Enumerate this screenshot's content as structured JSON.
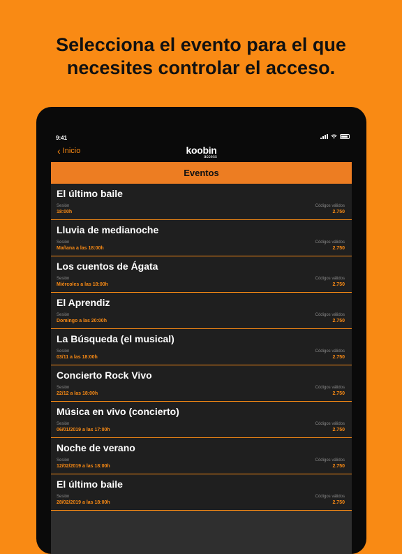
{
  "headline": {
    "line1": "Selecciona el evento para el que",
    "line2": "necesites controlar el acceso."
  },
  "status_bar": {
    "time": "9:41"
  },
  "nav": {
    "back_label": "Inicio",
    "logo_main": "koobin",
    "logo_sub": "access"
  },
  "screen_title": "Eventos",
  "labels": {
    "session": "Sesión",
    "codes": "Códigos válidos"
  },
  "events": [
    {
      "title": "El último baile",
      "session": "18:00h",
      "codes": "2.750"
    },
    {
      "title": "Lluvia de medianoche",
      "session": "Mañana a las 18:00h",
      "codes": "2.750"
    },
    {
      "title": "Los cuentos de Ágata",
      "session": "Miércoles a las 18:00h",
      "codes": "2.750"
    },
    {
      "title": "El Aprendiz",
      "session": "Domingo a las 20:00h",
      "codes": "2.750"
    },
    {
      "title": "La Búsqueda (el musical)",
      "session": "03/11 a las 18:00h",
      "codes": "2.750"
    },
    {
      "title": "Concierto Rock Vivo",
      "session": "22/12 a las 18:00h",
      "codes": "2.750"
    },
    {
      "title": "Música en vivo (concierto)",
      "session": "06/01/2019 a las 17:00h",
      "codes": "2.750"
    },
    {
      "title": "Noche de verano",
      "session": "12/02/2019 a las 18:00h",
      "codes": "2.750"
    },
    {
      "title": "El último baile",
      "session": "28/02/2019 a las 18:00h",
      "codes": "2.750"
    }
  ],
  "colors": {
    "accent": "#F98A14",
    "header": "#ED7D22",
    "row_bg": "#1f1f1f"
  }
}
